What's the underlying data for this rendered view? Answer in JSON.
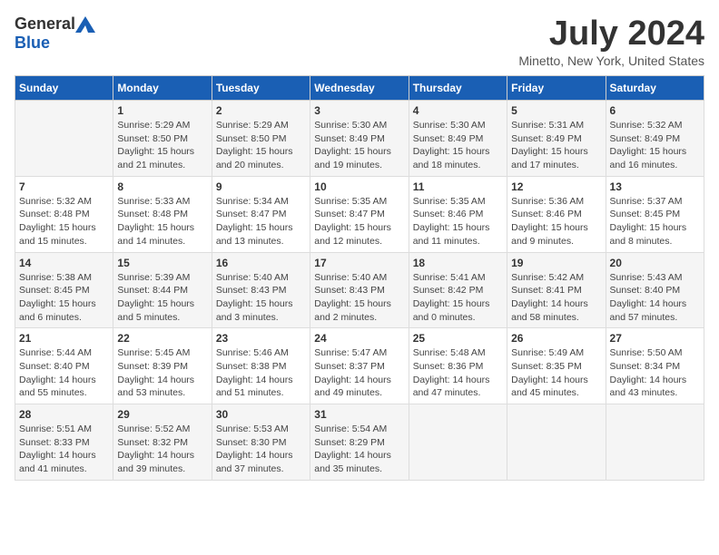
{
  "logo": {
    "general": "General",
    "blue": "Blue"
  },
  "title": "July 2024",
  "subtitle": "Minetto, New York, United States",
  "days_of_week": [
    "Sunday",
    "Monday",
    "Tuesday",
    "Wednesday",
    "Thursday",
    "Friday",
    "Saturday"
  ],
  "weeks": [
    [
      {
        "day": "",
        "info": ""
      },
      {
        "day": "1",
        "info": "Sunrise: 5:29 AM\nSunset: 8:50 PM\nDaylight: 15 hours\nand 21 minutes."
      },
      {
        "day": "2",
        "info": "Sunrise: 5:29 AM\nSunset: 8:50 PM\nDaylight: 15 hours\nand 20 minutes."
      },
      {
        "day": "3",
        "info": "Sunrise: 5:30 AM\nSunset: 8:49 PM\nDaylight: 15 hours\nand 19 minutes."
      },
      {
        "day": "4",
        "info": "Sunrise: 5:30 AM\nSunset: 8:49 PM\nDaylight: 15 hours\nand 18 minutes."
      },
      {
        "day": "5",
        "info": "Sunrise: 5:31 AM\nSunset: 8:49 PM\nDaylight: 15 hours\nand 17 minutes."
      },
      {
        "day": "6",
        "info": "Sunrise: 5:32 AM\nSunset: 8:49 PM\nDaylight: 15 hours\nand 16 minutes."
      }
    ],
    [
      {
        "day": "7",
        "info": "Sunrise: 5:32 AM\nSunset: 8:48 PM\nDaylight: 15 hours\nand 15 minutes."
      },
      {
        "day": "8",
        "info": "Sunrise: 5:33 AM\nSunset: 8:48 PM\nDaylight: 15 hours\nand 14 minutes."
      },
      {
        "day": "9",
        "info": "Sunrise: 5:34 AM\nSunset: 8:47 PM\nDaylight: 15 hours\nand 13 minutes."
      },
      {
        "day": "10",
        "info": "Sunrise: 5:35 AM\nSunset: 8:47 PM\nDaylight: 15 hours\nand 12 minutes."
      },
      {
        "day": "11",
        "info": "Sunrise: 5:35 AM\nSunset: 8:46 PM\nDaylight: 15 hours\nand 11 minutes."
      },
      {
        "day": "12",
        "info": "Sunrise: 5:36 AM\nSunset: 8:46 PM\nDaylight: 15 hours\nand 9 minutes."
      },
      {
        "day": "13",
        "info": "Sunrise: 5:37 AM\nSunset: 8:45 PM\nDaylight: 15 hours\nand 8 minutes."
      }
    ],
    [
      {
        "day": "14",
        "info": "Sunrise: 5:38 AM\nSunset: 8:45 PM\nDaylight: 15 hours\nand 6 minutes."
      },
      {
        "day": "15",
        "info": "Sunrise: 5:39 AM\nSunset: 8:44 PM\nDaylight: 15 hours\nand 5 minutes."
      },
      {
        "day": "16",
        "info": "Sunrise: 5:40 AM\nSunset: 8:43 PM\nDaylight: 15 hours\nand 3 minutes."
      },
      {
        "day": "17",
        "info": "Sunrise: 5:40 AM\nSunset: 8:43 PM\nDaylight: 15 hours\nand 2 minutes."
      },
      {
        "day": "18",
        "info": "Sunrise: 5:41 AM\nSunset: 8:42 PM\nDaylight: 15 hours\nand 0 minutes."
      },
      {
        "day": "19",
        "info": "Sunrise: 5:42 AM\nSunset: 8:41 PM\nDaylight: 14 hours\nand 58 minutes."
      },
      {
        "day": "20",
        "info": "Sunrise: 5:43 AM\nSunset: 8:40 PM\nDaylight: 14 hours\nand 57 minutes."
      }
    ],
    [
      {
        "day": "21",
        "info": "Sunrise: 5:44 AM\nSunset: 8:40 PM\nDaylight: 14 hours\nand 55 minutes."
      },
      {
        "day": "22",
        "info": "Sunrise: 5:45 AM\nSunset: 8:39 PM\nDaylight: 14 hours\nand 53 minutes."
      },
      {
        "day": "23",
        "info": "Sunrise: 5:46 AM\nSunset: 8:38 PM\nDaylight: 14 hours\nand 51 minutes."
      },
      {
        "day": "24",
        "info": "Sunrise: 5:47 AM\nSunset: 8:37 PM\nDaylight: 14 hours\nand 49 minutes."
      },
      {
        "day": "25",
        "info": "Sunrise: 5:48 AM\nSunset: 8:36 PM\nDaylight: 14 hours\nand 47 minutes."
      },
      {
        "day": "26",
        "info": "Sunrise: 5:49 AM\nSunset: 8:35 PM\nDaylight: 14 hours\nand 45 minutes."
      },
      {
        "day": "27",
        "info": "Sunrise: 5:50 AM\nSunset: 8:34 PM\nDaylight: 14 hours\nand 43 minutes."
      }
    ],
    [
      {
        "day": "28",
        "info": "Sunrise: 5:51 AM\nSunset: 8:33 PM\nDaylight: 14 hours\nand 41 minutes."
      },
      {
        "day": "29",
        "info": "Sunrise: 5:52 AM\nSunset: 8:32 PM\nDaylight: 14 hours\nand 39 minutes."
      },
      {
        "day": "30",
        "info": "Sunrise: 5:53 AM\nSunset: 8:30 PM\nDaylight: 14 hours\nand 37 minutes."
      },
      {
        "day": "31",
        "info": "Sunrise: 5:54 AM\nSunset: 8:29 PM\nDaylight: 14 hours\nand 35 minutes."
      },
      {
        "day": "",
        "info": ""
      },
      {
        "day": "",
        "info": ""
      },
      {
        "day": "",
        "info": ""
      }
    ]
  ]
}
